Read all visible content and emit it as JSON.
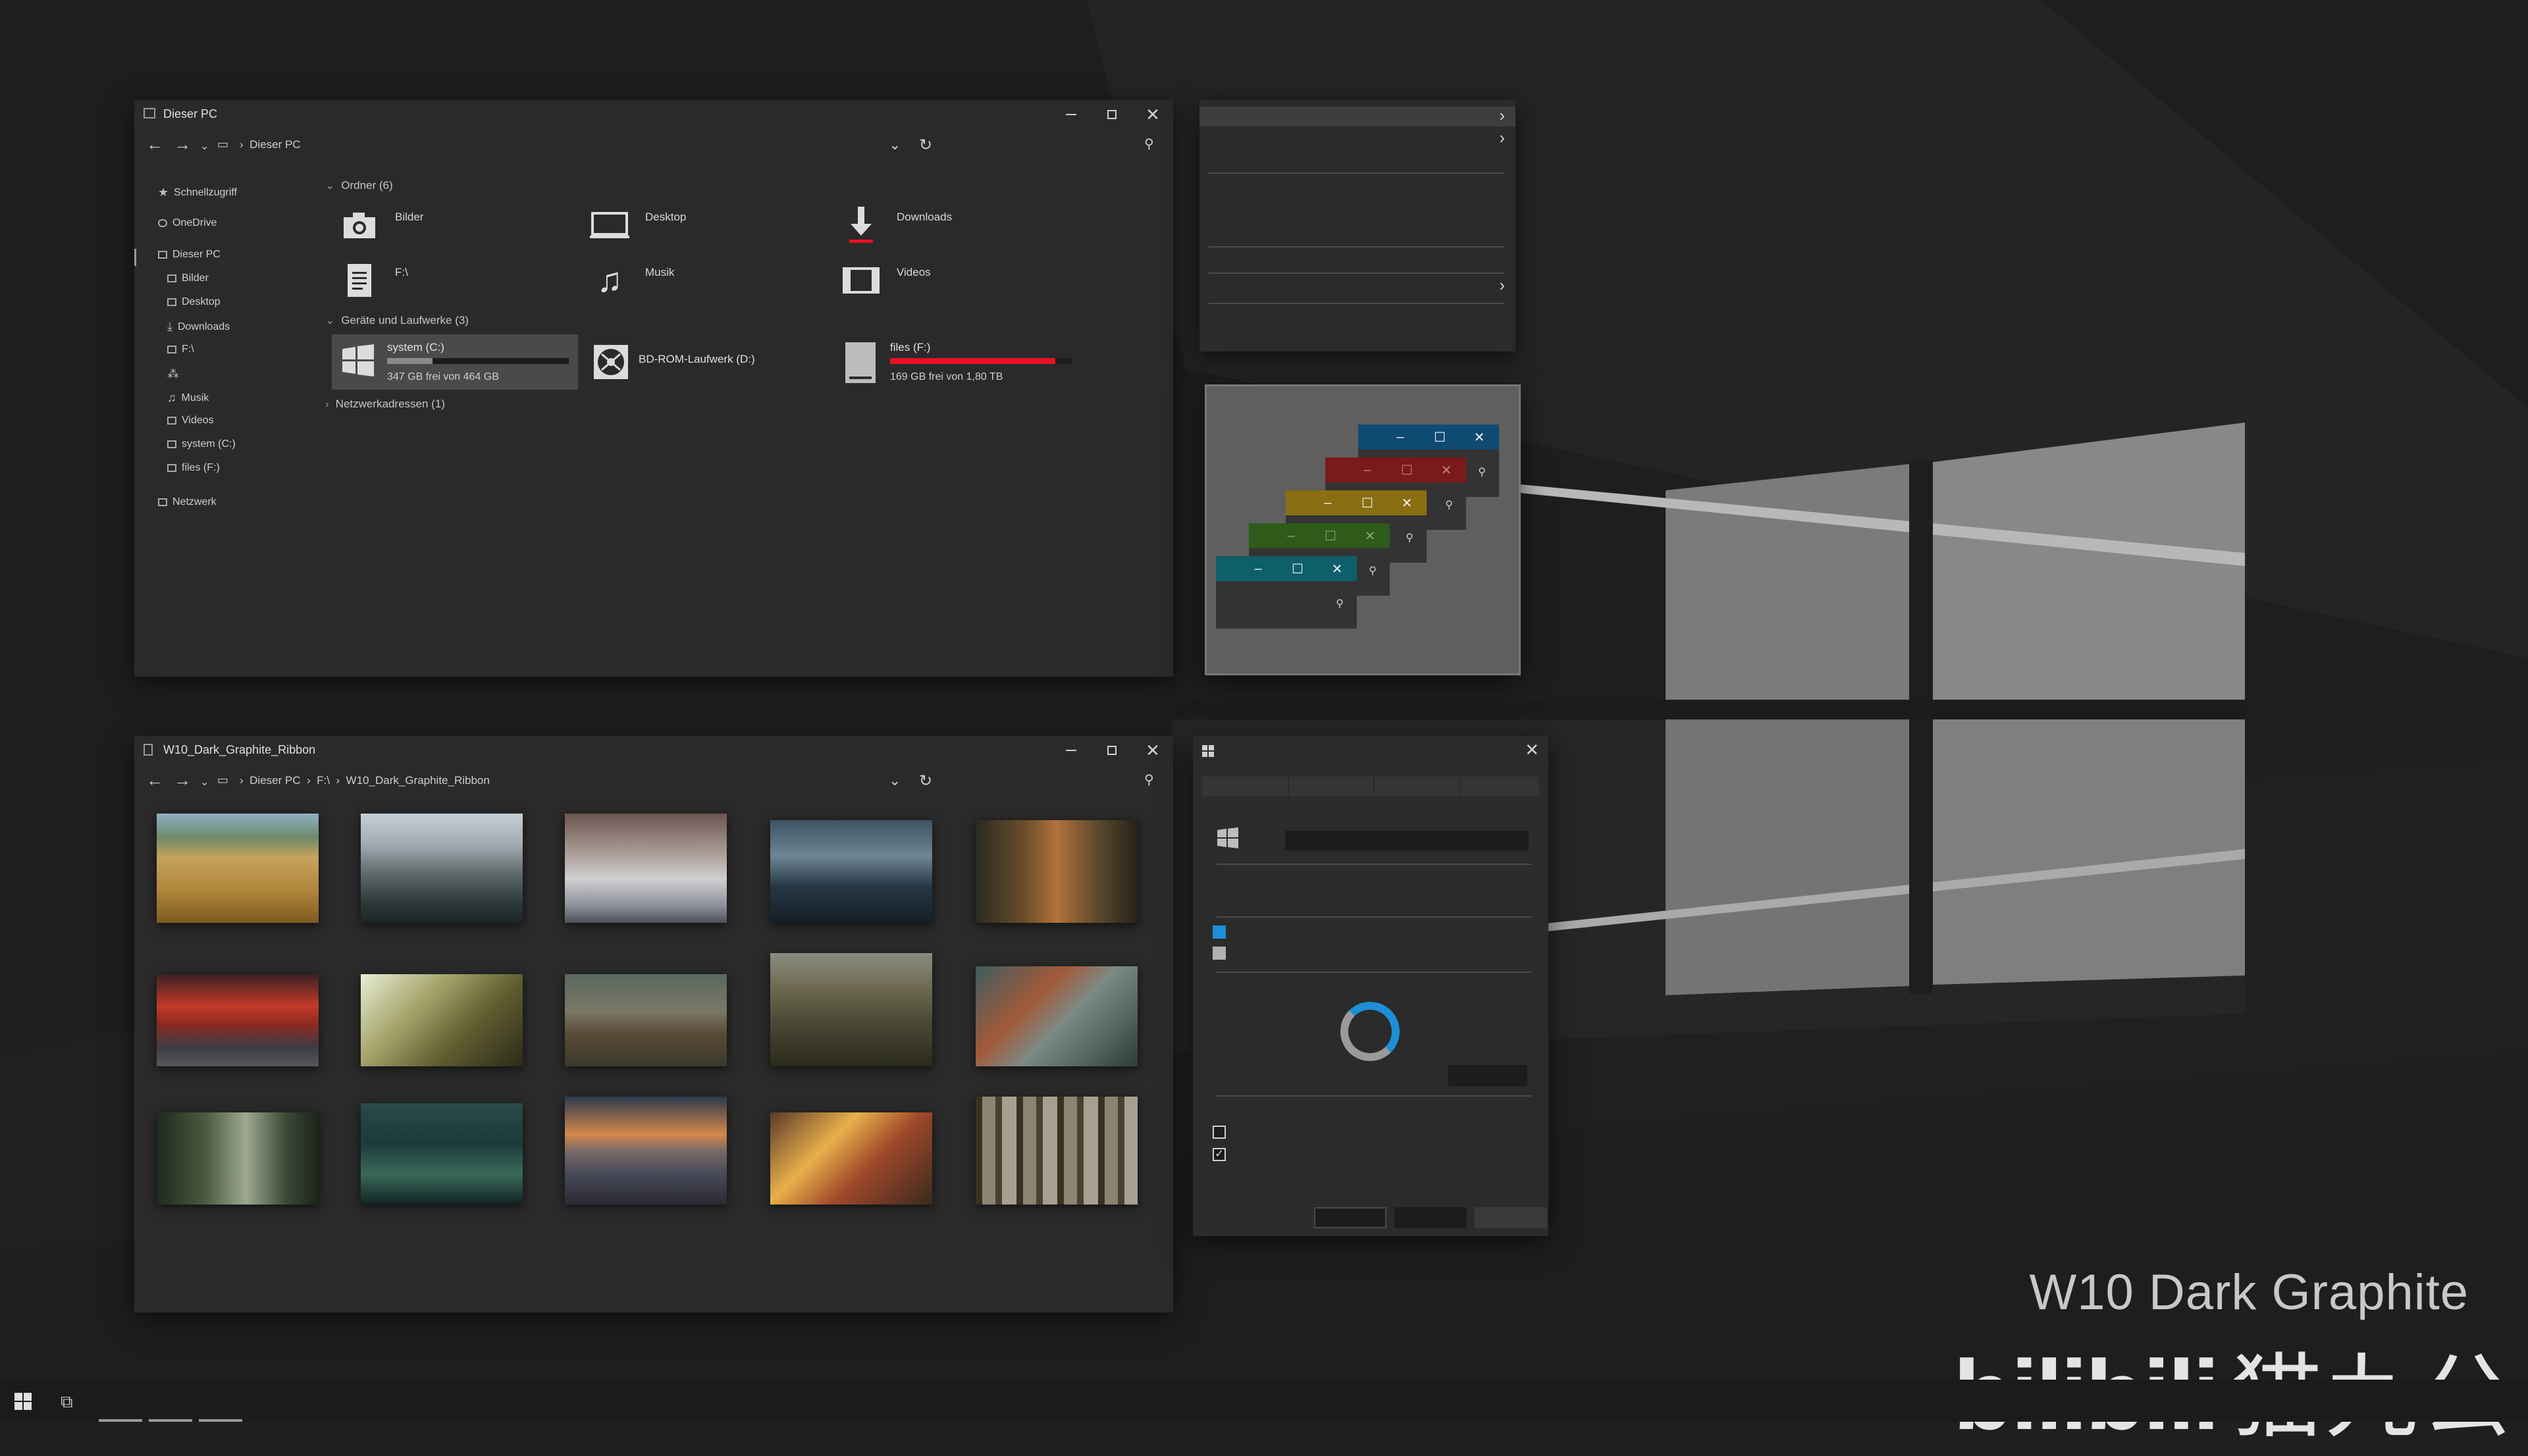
{
  "branding": {
    "title": "W10 Dark Graphite",
    "logo_text": "bilibili",
    "logo_cjk": "猫九公"
  },
  "explorer_pc": {
    "title": "Dieser PC",
    "path": "Dieser PC",
    "sidebar": [
      {
        "label": "Schnellzugriff",
        "icon": "star-icon"
      },
      {
        "label": "OneDrive",
        "icon": "cloud-icon"
      },
      {
        "label": "Dieser PC",
        "icon": "computer-icon"
      },
      {
        "label": "Bilder",
        "icon": "pictures-icon"
      },
      {
        "label": "Desktop",
        "icon": "desktop-icon"
      },
      {
        "label": "Downloads",
        "icon": "download-icon"
      },
      {
        "label": "F:\\",
        "icon": "document-icon"
      },
      {
        "label": "",
        "icon": "people-icon"
      },
      {
        "label": "Musik",
        "icon": "music-icon"
      },
      {
        "label": "Videos",
        "icon": "video-icon"
      },
      {
        "label": "system (C:)",
        "icon": "drive-icon"
      },
      {
        "label": "files (F:)",
        "icon": "drive-icon"
      },
      {
        "label": "Netzwerk",
        "icon": "network-icon"
      }
    ],
    "folders_header": "Ordner (6)",
    "folders": [
      {
        "label": "Bilder",
        "icon": "camera-icon"
      },
      {
        "label": "Desktop",
        "icon": "desktop-icon"
      },
      {
        "label": "Downloads",
        "icon": "download-icon"
      },
      {
        "label": "F:\\",
        "icon": "document-icon"
      },
      {
        "label": "Musik",
        "icon": "music-icon"
      },
      {
        "label": "Videos",
        "icon": "film-icon"
      }
    ],
    "drives_header": "Geräte und Laufwerke (3)",
    "drives": [
      {
        "label": "system (C:)",
        "free": "347 GB frei von 464 GB",
        "used_fraction": 0.25
      },
      {
        "label": "BD-ROM-Laufwerk (D:)",
        "free": "",
        "used_fraction": null
      },
      {
        "label": "files (F:)",
        "free": "169 GB frei von 1,80 TB",
        "used_fraction": 0.91
      }
    ],
    "network_header": "Netzwerkadressen (1)"
  },
  "explorer_folder": {
    "title": "W10_Dark_Graphite_Ribbon",
    "path": [
      "Dieser PC",
      "F:\\",
      "W10_Dark_Graphite_Ribbon"
    ],
    "thumbnail_count": 15
  },
  "color_windows": [
    {
      "color": "#0f4a72"
    },
    {
      "color": "#7a1a1a"
    },
    {
      "color": "#8a6e12"
    },
    {
      "color": "#2e5a1a"
    },
    {
      "color": "#0e5f6a"
    }
  ],
  "colors": {
    "accent_blue": "#1e8fd6",
    "danger_red": "#e81123"
  }
}
